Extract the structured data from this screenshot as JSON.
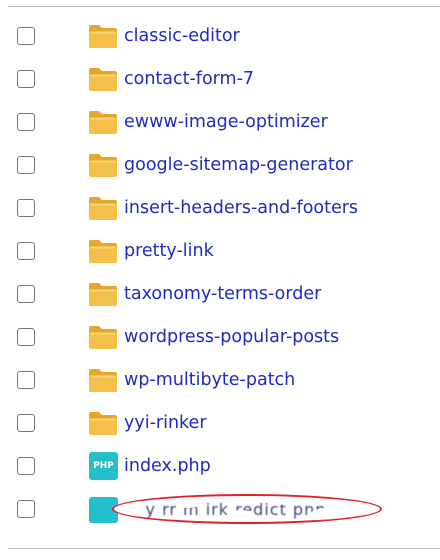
{
  "files": [
    {
      "name": "classic-editor",
      "type": "folder"
    },
    {
      "name": "contact-form-7",
      "type": "folder"
    },
    {
      "name": "ewww-image-optimizer",
      "type": "folder"
    },
    {
      "name": "google-sitemap-generator",
      "type": "folder"
    },
    {
      "name": "insert-headers-and-footers",
      "type": "folder"
    },
    {
      "name": "pretty-link",
      "type": "folder"
    },
    {
      "name": "taxonomy-terms-order",
      "type": "folder"
    },
    {
      "name": "wordpress-popular-posts",
      "type": "folder"
    },
    {
      "name": "wp-multibyte-patch",
      "type": "folder"
    },
    {
      "name": "yyi-rinker",
      "type": "folder"
    },
    {
      "name": "index.php",
      "type": "php",
      "icon_label": "PHP"
    }
  ],
  "obscured_file": {
    "text": "l y rr m irk redict pnp",
    "redaction_color": "#e0202a"
  },
  "colors": {
    "link": "#1e2bc0",
    "folder_fill": "#f5c04a",
    "folder_dark": "#e6a62c",
    "php_icon_bg": "#23c0cc",
    "checkbox_border": "#767676"
  },
  "icons": {
    "folder": "folder-icon",
    "php": "php-file-icon"
  }
}
